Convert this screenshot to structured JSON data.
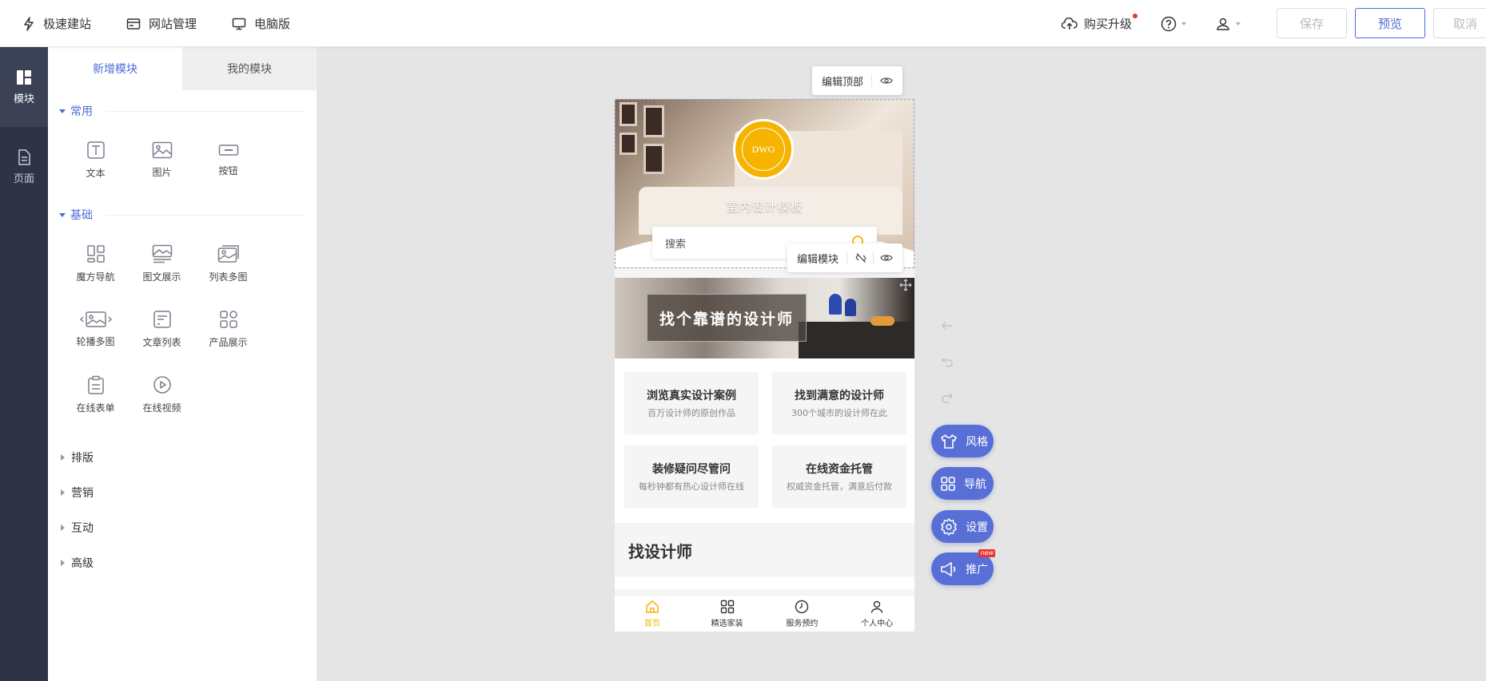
{
  "topbar": {
    "left_items": [
      {
        "label": "极速建站",
        "icon": "lightning-icon"
      },
      {
        "label": "网站管理",
        "icon": "site-manage-icon"
      },
      {
        "label": "电脑版",
        "icon": "monitor-icon"
      }
    ],
    "upgrade_label": "购买升级",
    "save_label": "保存",
    "preview_label": "预览",
    "cancel_label": "取消"
  },
  "darkbar": {
    "items": [
      {
        "label": "模块",
        "icon": "module-icon",
        "active": true
      },
      {
        "label": "页面",
        "icon": "page-icon",
        "active": false
      }
    ]
  },
  "panel": {
    "tabs": [
      {
        "label": "新增模块",
        "active": true
      },
      {
        "label": "我的模块",
        "active": false
      }
    ],
    "common": {
      "title": "常用",
      "items": [
        {
          "label": "文本",
          "icon": "text-icon"
        },
        {
          "label": "图片",
          "icon": "image-icon"
        },
        {
          "label": "按钮",
          "icon": "button-icon"
        }
      ]
    },
    "basic": {
      "title": "基础",
      "items": [
        {
          "label": "魔方导航",
          "icon": "cube-nav-icon"
        },
        {
          "label": "图文展示",
          "icon": "image-text-icon"
        },
        {
          "label": "列表多图",
          "icon": "list-images-icon"
        },
        {
          "label": "轮播多图",
          "icon": "carousel-icon"
        },
        {
          "label": "文章列表",
          "icon": "article-list-icon"
        },
        {
          "label": "产品展示",
          "icon": "product-icon"
        },
        {
          "label": "在线表单",
          "icon": "form-icon"
        },
        {
          "label": "在线视频",
          "icon": "video-icon"
        }
      ]
    },
    "collapsed_sections": [
      "排版",
      "营销",
      "互动",
      "高级"
    ]
  },
  "canvas": {
    "edit_top_label": "编辑顶部",
    "edit_module_label": "编辑模块",
    "phone": {
      "logo_text": "DWO",
      "site_name": "室内设计模板",
      "search_placeholder": "搜索",
      "banner_title": "找个靠谱的设计师",
      "features": [
        {
          "title": "浏览真实设计案例",
          "sub": "百万设计师的原创作品"
        },
        {
          "title": "找到满意的设计师",
          "sub": "300个城市的设计师在此"
        },
        {
          "title": "装修疑问尽管问",
          "sub": "每秒钟都有热心设计师在线"
        },
        {
          "title": "在线资金托管",
          "sub": "权威资金托管，满意后付款"
        }
      ],
      "section_title": "找设计师",
      "tabbar": [
        {
          "label": "首页",
          "icon": "home-icon",
          "active": true
        },
        {
          "label": "精选家装",
          "icon": "grid-icon",
          "active": false
        },
        {
          "label": "服务预约",
          "icon": "clock-icon",
          "active": false
        },
        {
          "label": "个人中心",
          "icon": "user-icon",
          "active": false
        }
      ]
    },
    "side_actions": [
      {
        "label": "风格",
        "icon": "shirt-icon"
      },
      {
        "label": "导航",
        "icon": "nav-grid-icon"
      },
      {
        "label": "设置",
        "icon": "settings-icon"
      },
      {
        "label": "推广",
        "icon": "megaphone-icon",
        "badge": "new"
      }
    ]
  },
  "colors": {
    "accent": "#4d6bd6",
    "pill": "#5870d6",
    "sidebar": "#2e3445",
    "logo": "#f6b400"
  }
}
